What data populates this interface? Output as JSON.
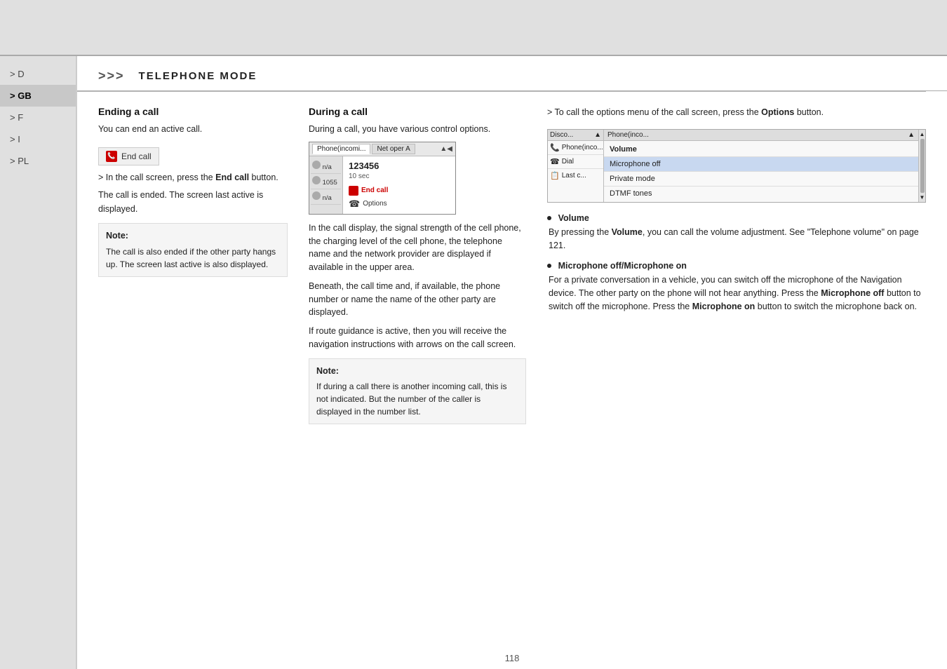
{
  "page": {
    "number": "118",
    "top_bar": "",
    "header": {
      "arrows": ">>>",
      "title": "TELEPHONE MODE"
    }
  },
  "sidebar": {
    "items": [
      {
        "label": "> D",
        "active": false
      },
      {
        "label": "> GB",
        "active": true
      },
      {
        "label": "> F",
        "active": false
      },
      {
        "label": "> I",
        "active": false
      },
      {
        "label": "> PL",
        "active": false
      }
    ]
  },
  "left_column": {
    "heading": "Ending a call",
    "intro": "You can end an active call.",
    "end_call_button_label": "End call",
    "instruction": "> In the call screen, press the End call button.",
    "instruction_bold": "End call",
    "result_text": "The call is ended. The screen last active is displayed.",
    "note_label": "Note:",
    "note_text": "The call is also ended if the other party hangs up. The screen last active is also displayed."
  },
  "middle_column": {
    "heading": "During a call",
    "intro": "During a call, you have various control options.",
    "phone_mockup": {
      "tab1": "Phone(incomi...",
      "tab2": "Net oper A",
      "signal": "▲◀",
      "list_items": [
        {
          "icon": "phone",
          "label": "n/a"
        },
        {
          "icon": "phone",
          "label": "1055"
        },
        {
          "icon": "phone",
          "label": "n/a"
        }
      ],
      "number": "123456",
      "time": "10 sec",
      "end_call_label": "End call",
      "options_label": "Options"
    },
    "body_text_1": "In the call display, the signal strength of the cell phone, the charging level of the cell phone, the telephone name and the network provider are displayed if available in the upper area.",
    "body_text_2": "Beneath, the call time and, if available, the phone number or name the name of the other party are displayed.",
    "body_text_3": "If route guidance is active, then you will receive the navigation instructions with arrows on the call screen.",
    "note_label": "Note:",
    "note_text": "If during a call there is another incoming call, this is not indicated. But the number of the caller is displayed in the number list."
  },
  "right_column": {
    "intro": "> To call the options menu of the call screen, press the Options button.",
    "intro_bold": "Options",
    "options_mockup": {
      "col1_header": "Disco...",
      "col2_header": "Phone(inco...",
      "rows": [
        {
          "icon": "phone",
          "label": "Phone(inco..."
        },
        {
          "icon": "dial",
          "label": "Dial"
        },
        {
          "icon": "last",
          "label": "Last c..."
        }
      ],
      "menu_items": [
        {
          "label": "Volume",
          "highlighted": false
        },
        {
          "label": "Microphone off",
          "highlighted": true
        },
        {
          "label": "Private mode",
          "highlighted": false
        },
        {
          "label": "DTMF tones",
          "highlighted": false
        }
      ]
    },
    "bullets": [
      {
        "title": "Volume",
        "body": "By pressing the Volume, you can call the volume adjustment. See \"Telephone volume\" on page 121.",
        "bold_words": [
          "Volume"
        ]
      },
      {
        "title": "Microphone off/Microphone on",
        "body": "For a private conversation in a vehicle, you can switch off the microphone of the Navigation device. The other party on the phone will not hear anything. Press the Microphone off button to switch off the microphone. Press the Microphone on button to switch the microphone back on.",
        "bold_words": [
          "Microphone off",
          "Microphone on"
        ]
      }
    ]
  }
}
